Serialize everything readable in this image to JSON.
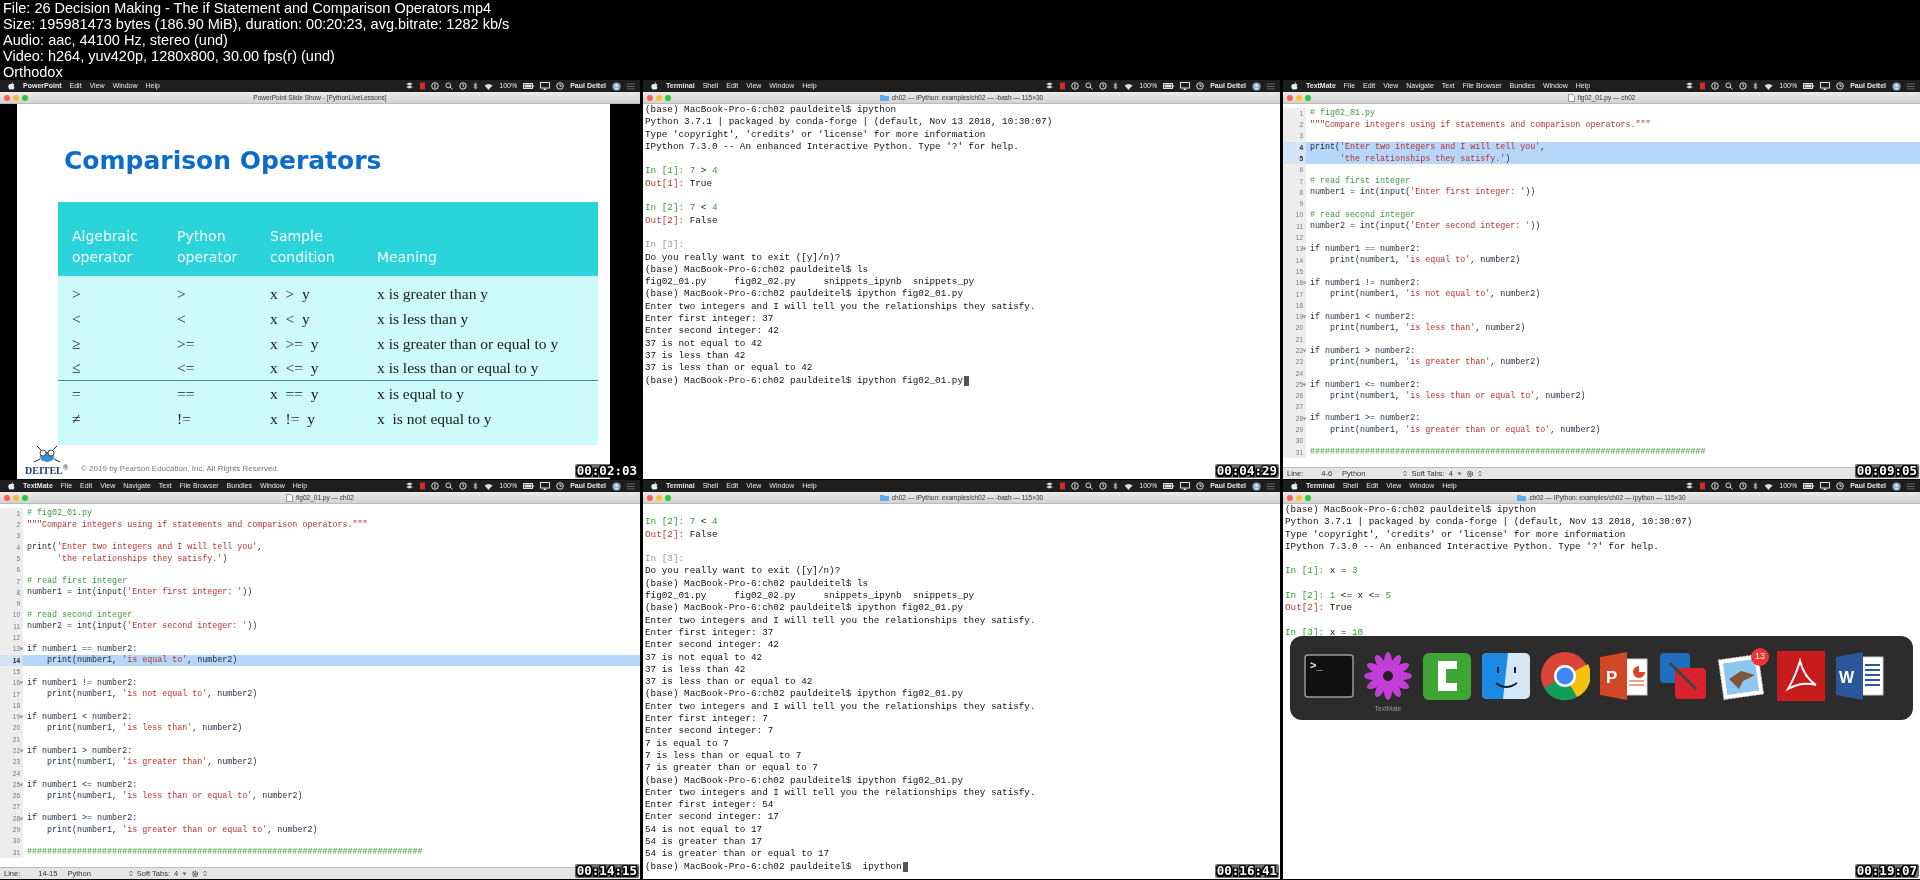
{
  "file_info": [
    "File: 26 Decision Making - The if Statement and Comparison Operators.mp4",
    "Size: 195981473 bytes (186.90 MiB), duration: 00:20:23, avg.bitrate: 1282 kb/s",
    "Audio: aac, 44100 Hz, stereo (und)",
    "Video: h264, yuv420p, 1280x800, 30.00 fps(r) (und)",
    "Orthodox"
  ],
  "frames": [
    {
      "kind": "slide",
      "app": "PowerPoint",
      "menus": [
        "Edit",
        "View",
        "Window",
        "Help"
      ],
      "battery": "100%",
      "user": "Paul Deitel",
      "title": "PowerPoint Slide Show - [PythonLiveLessons]",
      "timestamp": "00:02:03",
      "slide": {
        "heading": "Comparison Operators",
        "columns": [
          "Algebraic\noperator",
          "Python\noperator",
          "Sample\ncondition",
          "Meaning"
        ],
        "rows": [
          {
            "cells": [
              ">",
              ">",
              "x  >  y",
              "x is greater than y"
            ],
            "rule_below": false
          },
          {
            "cells": [
              "<",
              "<",
              "x  <  y",
              "x is less than y"
            ],
            "rule_below": false
          },
          {
            "cells": [
              "≥",
              ">=",
              "x  >=  y",
              "x is greater than or equal to y"
            ],
            "rule_below": false
          },
          {
            "cells": [
              "≤",
              "<=",
              "x  <=  y",
              "x is less than or equal to y"
            ],
            "rule_below": true
          },
          {
            "cells": [
              "=",
              "==",
              "x  ==  y",
              "x is equal to y"
            ],
            "rule_below": false
          },
          {
            "cells": [
              "≠",
              "!=",
              "x  !=  y",
              "x  is not equal to y"
            ],
            "rule_below": false
          }
        ],
        "logo": "DEITEL$^{®}$",
        "copyright": "© 2019 by Pearson Education, Inc. All Rights Reserved."
      }
    },
    {
      "kind": "terminal",
      "app": "Terminal",
      "menus": [
        "Shell",
        "Edit",
        "View",
        "Window",
        "Help"
      ],
      "battery": "100%",
      "user": "Paul Deitel",
      "title": "ch02 — IPython: examples/ch02 — -bash — 115×30",
      "timestamp": "00:04:29",
      "cursor_after_last_line": true,
      "lines": [
        {
          "kind": "plain",
          "text": "(base) MacBook-Pro-6:ch02 pauldeitel$ ipython"
        },
        {
          "kind": "plain",
          "text": "Python 3.7.1 | packaged by conda-forge | (default, Nov 13 2018, 10:30:07)"
        },
        {
          "kind": "plain",
          "text": "Type 'copyright', 'credits' or 'license' for more information"
        },
        {
          "kind": "plain",
          "text": "IPython 7.3.0 -- An enhanced Interactive Python. Type '?' for help."
        },
        {
          "kind": "blank"
        },
        {
          "kind": "in",
          "prompt": "In [1]:",
          "text": " 7 > 4"
        },
        {
          "kind": "out",
          "prompt": "Out[1]:",
          "text": " True"
        },
        {
          "kind": "blank"
        },
        {
          "kind": "in",
          "prompt": "In [2]:",
          "text": " 7 < 4"
        },
        {
          "kind": "out",
          "prompt": "Out[2]:",
          "text": " False"
        },
        {
          "kind": "blank"
        },
        {
          "kind": "dim",
          "prompt": "In [3]:"
        },
        {
          "kind": "plain",
          "text": "Do you really want to exit ([y]/n)?"
        },
        {
          "kind": "plain",
          "text": "(base) MacBook-Pro-6:ch02 pauldeitel$ ls"
        },
        {
          "kind": "plain",
          "text": "fig02_01.py     fig02_02.py     snippets_ipynb  snippets_py"
        },
        {
          "kind": "plain",
          "text": "(base) MacBook-Pro-6:ch02 pauldeitel$ ipython fig02_01.py"
        },
        {
          "kind": "plain",
          "text": "Enter two integers and I will tell you the relationships they satisfy."
        },
        {
          "kind": "plain",
          "text": "Enter first integer: 37"
        },
        {
          "kind": "plain",
          "text": "Enter second integer: 42"
        },
        {
          "kind": "plain",
          "text": "37 is not equal to 42"
        },
        {
          "kind": "plain",
          "text": "37 is less than 42"
        },
        {
          "kind": "plain",
          "text": "37 is less than or equal to 42"
        },
        {
          "kind": "plain",
          "text": "(base) MacBook-Pro-6:ch02 pauldeitel$ ipython fig02_01.py"
        }
      ]
    },
    {
      "kind": "editor",
      "app": "TextMate",
      "menus": [
        "File",
        "Edit",
        "View",
        "Navigate",
        "Text",
        "File Browser",
        "Bundles",
        "Window",
        "Help"
      ],
      "battery": "100%",
      "user": "Paul Deitel",
      "title": "fig02_01.py — ch02",
      "timestamp": "00:09:05",
      "code": [
        {
          "n": "1",
          "code": "# fig02_01.py",
          "selected": false,
          "fold": false
        },
        {
          "n": "2",
          "code": "\"\"\"Compare integers using if statements and comparison operators.\"\"\"",
          "selected": false,
          "fold": false
        },
        {
          "n": "3",
          "selected": false,
          "fold": false
        },
        {
          "n": "4",
          "code": "print('Enter two integers and I will tell you',",
          "selected": true,
          "fold": false
        },
        {
          "n": "5",
          "code": "      'the relationships they satisfy.')",
          "selected": true,
          "fold": false
        },
        {
          "n": "6",
          "selected": false,
          "fold": false
        },
        {
          "n": "7",
          "code": "# read first integer",
          "selected": false,
          "fold": false
        },
        {
          "n": "8",
          "code": "number1 = int(input('Enter first integer: '))",
          "selected": false,
          "fold": false
        },
        {
          "n": "9",
          "selected": false,
          "fold": false
        },
        {
          "n": "10",
          "code": "# read second integer",
          "selected": false,
          "fold": false
        },
        {
          "n": "11",
          "code": "number2 = int(input('Enter second integer: '))",
          "selected": false,
          "fold": false
        },
        {
          "n": "12",
          "selected": false,
          "fold": false
        },
        {
          "n": "13",
          "code": "if number1 == number2:",
          "selected": false,
          "fold": true
        },
        {
          "n": "14",
          "code": "    print(number1, 'is equal to', number2)",
          "selected": false,
          "fold": false
        },
        {
          "n": "15",
          "selected": false,
          "fold": false
        },
        {
          "n": "16",
          "code": "if number1 != number2:",
          "selected": false,
          "fold": true
        },
        {
          "n": "17",
          "code": "    print(number1, 'is not equal to', number2)",
          "selected": false,
          "fold": false
        },
        {
          "n": "18",
          "selected": false,
          "fold": false
        },
        {
          "n": "19",
          "code": "if number1 < number2:",
          "selected": false,
          "fold": true
        },
        {
          "n": "20",
          "code": "    print(number1, 'is less than', number2)",
          "selected": false,
          "fold": false
        },
        {
          "n": "21",
          "selected": false,
          "fold": false
        },
        {
          "n": "22",
          "code": "if number1 > number2:",
          "selected": false,
          "fold": true
        },
        {
          "n": "23",
          "code": "    print(number1, 'is greater than', number2)",
          "selected": false,
          "fold": false
        },
        {
          "n": "24",
          "selected": false,
          "fold": false
        },
        {
          "n": "25",
          "code": "if number1 <= number2:",
          "selected": false,
          "fold": true
        },
        {
          "n": "26",
          "code": "    print(number1, 'is less than or equal to', number2)",
          "selected": false,
          "fold": false
        },
        {
          "n": "27",
          "selected": false,
          "fold": false
        },
        {
          "n": "28",
          "code": "if number1 >= number2:",
          "selected": false,
          "fold": true
        },
        {
          "n": "29",
          "code": "    print(number1, 'is greater than or equal to', number2)",
          "selected": false,
          "fold": false
        },
        {
          "n": "30",
          "selected": false,
          "fold": false
        },
        {
          "n": "31",
          "code": "###############################################################################",
          "selected": false,
          "fold": false
        }
      ],
      "status": {
        "line_label": "Line:",
        "line": "4-6",
        "language": "Python",
        "tabs_label": "Soft Tabs:",
        "tabs": "4"
      }
    },
    {
      "kind": "editor",
      "app": "TextMate",
      "menus": [
        "File",
        "Edit",
        "View",
        "Navigate",
        "Text",
        "File Browser",
        "Bundles",
        "Window",
        "Help"
      ],
      "battery": "100%",
      "user": "Paul Deitel",
      "title": "fig02_01.py — ch02",
      "timestamp": "00:14:15",
      "code": [
        {
          "n": "1",
          "code": "# fig02_01.py",
          "selected": false,
          "fold": false
        },
        {
          "n": "2",
          "code": "\"\"\"Compare integers using if statements and comparison operators.\"\"\"",
          "selected": false,
          "fold": false
        },
        {
          "n": "3",
          "selected": false,
          "fold": false
        },
        {
          "n": "4",
          "code": "print('Enter two integers and I will tell you',",
          "selected": false,
          "fold": false
        },
        {
          "n": "5",
          "code": "      'the relationships they satisfy.')",
          "selected": false,
          "fold": false
        },
        {
          "n": "6",
          "selected": false,
          "fold": false
        },
        {
          "n": "7",
          "code": "# read first integer",
          "selected": false,
          "fold": false
        },
        {
          "n": "8",
          "code": "number1 = int(input('Enter first integer: '))",
          "selected": false,
          "fold": false
        },
        {
          "n": "9",
          "selected": false,
          "fold": false
        },
        {
          "n": "10",
          "code": "# read second integer",
          "selected": false,
          "fold": false
        },
        {
          "n": "11",
          "code": "number2 = int(input('Enter second integer: '))",
          "selected": false,
          "fold": false
        },
        {
          "n": "12",
          "selected": false,
          "fold": false
        },
        {
          "n": "13",
          "code": "if number1 == number2:",
          "selected": false,
          "fold": true
        },
        {
          "n": "14",
          "code": "    print(number1, 'is equal to', number2)",
          "selected": true,
          "fold": false
        },
        {
          "n": "15",
          "selected": false,
          "fold": false
        },
        {
          "n": "16",
          "code": "if number1 != number2:",
          "selected": false,
          "fold": true
        },
        {
          "n": "17",
          "code": "    print(number1, 'is not equal to', number2)",
          "selected": false,
          "fold": false
        },
        {
          "n": "18",
          "selected": false,
          "fold": false
        },
        {
          "n": "19",
          "code": "if number1 < number2:",
          "selected": false,
          "fold": true
        },
        {
          "n": "20",
          "code": "    print(number1, 'is less than', number2)",
          "selected": false,
          "fold": false
        },
        {
          "n": "21",
          "selected": false,
          "fold": false
        },
        {
          "n": "22",
          "code": "if number1 > number2:",
          "selected": false,
          "fold": true
        },
        {
          "n": "23",
          "code": "    print(number1, 'is greater than', number2)",
          "selected": false,
          "fold": false
        },
        {
          "n": "24",
          "selected": false,
          "fold": false
        },
        {
          "n": "25",
          "code": "if number1 <= number2:",
          "selected": false,
          "fold": true
        },
        {
          "n": "26",
          "code": "    print(number1, 'is less than or equal to', number2)",
          "selected": false,
          "fold": false
        },
        {
          "n": "27",
          "selected": false,
          "fold": false
        },
        {
          "n": "28",
          "code": "if number1 >= number2:",
          "selected": false,
          "fold": true
        },
        {
          "n": "29",
          "code": "    print(number1, 'is greater than or equal to', number2)",
          "selected": false,
          "fold": false
        },
        {
          "n": "30",
          "selected": false,
          "fold": false
        },
        {
          "n": "31",
          "code": "###############################################################################",
          "selected": false,
          "fold": false
        }
      ],
      "status": {
        "line_label": "Line:",
        "line": "14-15",
        "language": "Python",
        "tabs_label": "Soft Tabs:",
        "tabs": "4"
      }
    },
    {
      "kind": "terminal",
      "app": "Terminal",
      "menus": [
        "Shell",
        "Edit",
        "View",
        "Window",
        "Help"
      ],
      "battery": "100%",
      "user": "Paul Deitel",
      "title": "ch02 — IPython: examples/ch02 — -bash — 115×30",
      "timestamp": "00:16:41",
      "cursor_after_last_line": true,
      "lines": [
        {
          "kind": "blank"
        },
        {
          "kind": "in",
          "prompt": "In [2]:",
          "text": " 7 < 4"
        },
        {
          "kind": "out",
          "prompt": "Out[2]:",
          "text": " False"
        },
        {
          "kind": "blank"
        },
        {
          "kind": "dim",
          "prompt": "In [3]:"
        },
        {
          "kind": "plain",
          "text": "Do you really want to exit ([y]/n)?"
        },
        {
          "kind": "plain",
          "text": "(base) MacBook-Pro-6:ch02 pauldeitel$ ls"
        },
        {
          "kind": "plain",
          "text": "fig02_01.py     fig02_02.py     snippets_ipynb  snippets_py"
        },
        {
          "kind": "plain",
          "text": "(base) MacBook-Pro-6:ch02 pauldeitel$ ipython fig02_01.py"
        },
        {
          "kind": "plain",
          "text": "Enter two integers and I will tell you the relationships they satisfy."
        },
        {
          "kind": "plain",
          "text": "Enter first integer: 37"
        },
        {
          "kind": "plain",
          "text": "Enter second integer: 42"
        },
        {
          "kind": "plain",
          "text": "37 is not equal to 42"
        },
        {
          "kind": "plain",
          "text": "37 is less than 42"
        },
        {
          "kind": "plain",
          "text": "37 is less than or equal to 42"
        },
        {
          "kind": "plain",
          "text": "(base) MacBook-Pro-6:ch02 pauldeitel$ ipython fig02_01.py"
        },
        {
          "kind": "plain",
          "text": "Enter two integers and I will tell you the relationships they satisfy."
        },
        {
          "kind": "plain",
          "text": "Enter first integer: 7"
        },
        {
          "kind": "plain",
          "text": "Enter second integer: 7"
        },
        {
          "kind": "plain",
          "text": "7 is equal to 7"
        },
        {
          "kind": "plain",
          "text": "7 is less than or equal to 7"
        },
        {
          "kind": "plain",
          "text": "7 is greater than or equal to 7"
        },
        {
          "kind": "plain",
          "text": "(base) MacBook-Pro-6:ch02 pauldeitel$ ipython fig02_01.py"
        },
        {
          "kind": "plain",
          "text": "Enter two integers and I will tell you the relationships they satisfy."
        },
        {
          "kind": "plain",
          "text": "Enter first integer: 54"
        },
        {
          "kind": "plain",
          "text": "Enter second integer: 17"
        },
        {
          "kind": "plain",
          "text": "54 is not equal to 17"
        },
        {
          "kind": "plain",
          "text": "54 is greater than 17"
        },
        {
          "kind": "plain",
          "text": "54 is greater than or equal to 17"
        },
        {
          "kind": "plain",
          "text": "(base) MacBook-Pro-6:ch02 pauldeitel$  ipython"
        }
      ]
    },
    {
      "kind": "terminal",
      "app": "Terminal",
      "menus": [
        "Shell",
        "Edit",
        "View",
        "Window",
        "Help"
      ],
      "battery": "100%",
      "user": "Paul Deitel",
      "title": "ch02 — IPython: examples/ch02 — ipython — 115×30",
      "timestamp": "00:19:07",
      "cursor_after_last_line": false,
      "lines": [
        {
          "kind": "plain",
          "text": "(base) MacBook-Pro-6:ch02 pauldeitel$ ipython"
        },
        {
          "kind": "plain",
          "text": "Python 3.7.1 | packaged by conda-forge | (default, Nov 13 2018, 10:30:07)"
        },
        {
          "kind": "plain",
          "text": "Type 'copyright', 'credits' or 'license' for more information"
        },
        {
          "kind": "plain",
          "text": "IPython 7.3.0 -- An enhanced Interactive Python. Type '?' for help."
        },
        {
          "kind": "blank"
        },
        {
          "kind": "in",
          "prompt": "In [1]:",
          "text": " x = 3"
        },
        {
          "kind": "blank"
        },
        {
          "kind": "in",
          "prompt": "In [2]:",
          "text": " 1 <= x <= 5"
        },
        {
          "kind": "out",
          "prompt": "Out[2]:",
          "text": " True"
        },
        {
          "kind": "blank"
        },
        {
          "kind": "in",
          "prompt": "In [3]:",
          "text": " x = 10"
        }
      ],
      "dock": [
        {
          "kind": "terminal",
          "glyph": ">_"
        },
        {
          "kind": "flower",
          "label": "TextMate"
        },
        {
          "kind": "c-shape"
        },
        {
          "kind": "finder"
        },
        {
          "kind": "chrome"
        },
        {
          "kind": "slides",
          "glyph": "P"
        },
        {
          "kind": "squares"
        },
        {
          "kind": "stamp",
          "badge": "13"
        },
        {
          "kind": "acrobat"
        },
        {
          "kind": "document",
          "glyph": "W"
        }
      ]
    }
  ]
}
